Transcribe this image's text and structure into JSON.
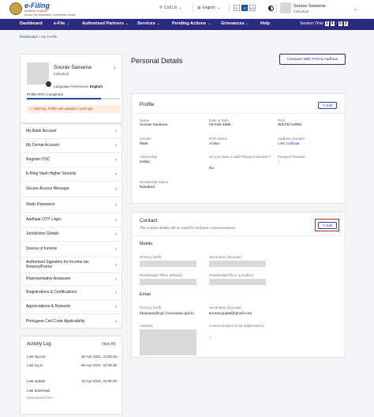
{
  "header": {
    "brand": "e-Filing",
    "tagline": "Anywhere Anytime",
    "dept": "Income Tax Department, Government of India",
    "call_us": "Call Us",
    "language": "English",
    "font_sizes": [
      "A-",
      "A",
      "A+"
    ],
    "user_name": "Sourav Saxsena",
    "user_role": "Individual"
  },
  "nav": {
    "items": [
      {
        "label": "Dashboard",
        "chevron": false
      },
      {
        "label": "e-File",
        "chevron": true
      },
      {
        "label": "Authorised Partners",
        "chevron": true
      },
      {
        "label": "Services",
        "chevron": true
      },
      {
        "label": "Pending Actions",
        "chevron": true
      },
      {
        "label": "Grievances",
        "chevron": true
      },
      {
        "label": "Help",
        "chevron": false
      }
    ],
    "session_label": "Session Time",
    "session_digits": [
      "1",
      "4",
      "5",
      "3"
    ]
  },
  "breadcrumb": {
    "home": "Dashboard",
    "sep": ">",
    "current": "My Profile"
  },
  "profile_card": {
    "name": "Sourav Saxsena",
    "role": "Individual",
    "language_label": "Language Preference:",
    "language_value": "English",
    "completion_label": "Profile",
    "completion_value": "80% Completed",
    "completion_fraction": 0.8,
    "warning": "Warning: Profile last updated 1 year ago."
  },
  "menu": [
    "My Bank Account",
    "My Demat Account",
    "Register DSC",
    "E-filing Vault-Higher Security",
    "Secure Access Message",
    "Static Password",
    "Aadhaar OTP Login",
    "Jurisdiction Details",
    "Source of Income",
    "Authorised Signatory for Income tax Returns/Forms",
    "Representative Assessee",
    "Registrations & Certifications",
    "Appreciations & Rewards",
    "Portugese Civil Code Applicability"
  ],
  "activity": {
    "title": "Activity Log",
    "view_all": "View All",
    "rows": [
      {
        "label": "Last log out",
        "value": "20-Apr-2021, 22:05:26"
      },
      {
        "label": "Last log in",
        "value": "20-Apr-2021, 22:05:26"
      },
      {
        "label": "Last update",
        "value": "13-Apr-2021, 22:05:26"
      },
      {
        "label": "Last download",
        "value": ""
      }
    ],
    "download_note": "Downloaded form"
  },
  "main": {
    "title": "Personal Details",
    "compare_button": "Compare With PAN & Aadhaar",
    "profile": {
      "title": "Profile",
      "edit": "Edit",
      "fields": {
        "name_label": "Name",
        "name_value": "Sourav Saxsena",
        "dob_label": "Date of Birth",
        "dob_value": "03-Feb-1995",
        "pan_label": "PAN",
        "pan_value": "WILPE7199W",
        "gender_label": "Gender",
        "gender_value": "Male",
        "pan_status_label": "PAN Status",
        "pan_status_value": "Active",
        "aadhaar_label": "Aadhaar Number",
        "aadhaar_value": "Link Aadhaar",
        "citizenship_label": "Citizenship",
        "citizenship_value": "Indian",
        "valid_passport_label": "Do you have a valid Passport Number?",
        "valid_passport_value": "No",
        "passport_label": "Passport Number",
        "passport_value": "--",
        "residential_label": "Residential Status",
        "residential_value": "Resident"
      }
    },
    "contact": {
      "title": "Contact",
      "subtitle": "The contact details will be used for all future communications.",
      "edit": "Edit",
      "mobile_heading": "Mobile",
      "primary_mobile_label": "Primary (Self)",
      "secondary_mobile_label": "Secondary (Spouse)",
      "residential_mobile_label": "Residential/ Office (Mobile)",
      "residential_landline_label": "Residential/Office (Landline)",
      "email_heading": "Email",
      "primary_email_label": "Primary (Self)",
      "primary_email_value": "bhawana@cpc.incometax.gov.in",
      "secondary_email_label": "Secondary (Spouse)",
      "secondary_email_value": "sourav.gupta@gmail.com",
      "address_label": "Address",
      "comm_label": "Communication to be addressed to",
      "comm_value": "--"
    }
  },
  "colors": {
    "nav_bg": "#2b2a80",
    "accent": "#1d4fa8",
    "warning_bg": "#fdeee0",
    "warning_text": "#c0392b",
    "highlight": "#c62828"
  }
}
